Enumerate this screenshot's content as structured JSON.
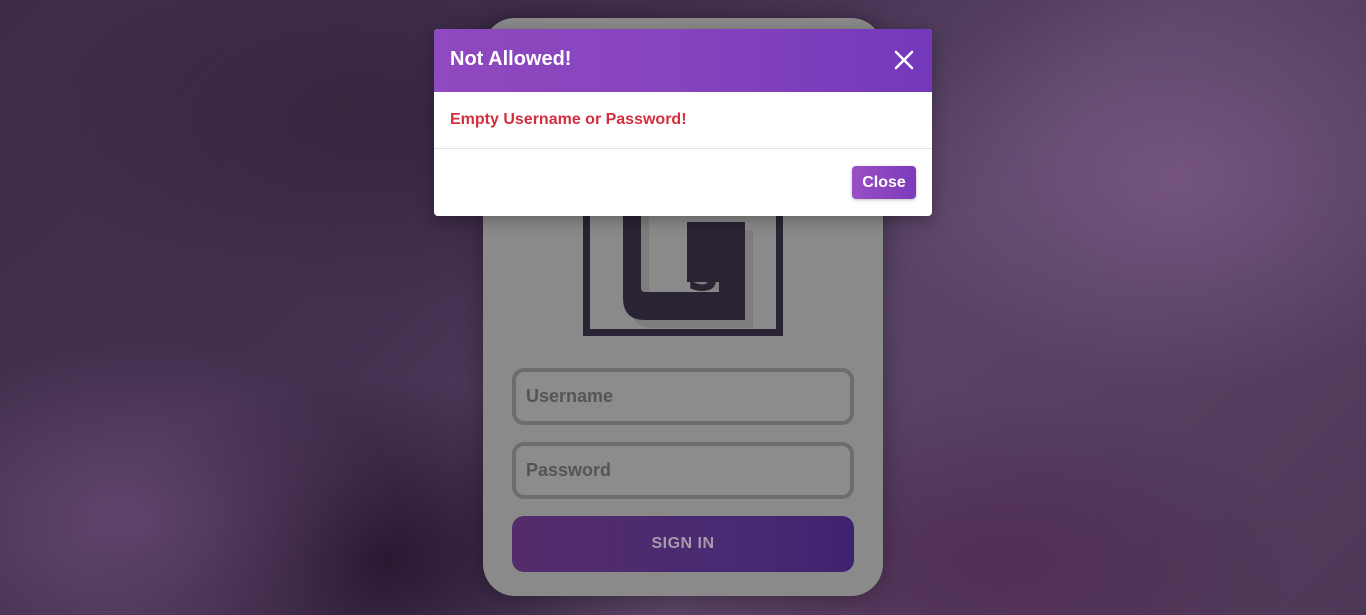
{
  "login": {
    "username_placeholder": "Username",
    "password_placeholder": "Password",
    "signin_label": "SIGN IN",
    "logo_letter": "S"
  },
  "modal": {
    "title": "Not Allowed!",
    "message": "Empty Username or Password!",
    "close_label": "Close"
  },
  "colors": {
    "modal_header": "#8443bd",
    "error_text": "#d32f3f",
    "card": "#8a8a8a",
    "signin_button": "#4a2a72"
  }
}
